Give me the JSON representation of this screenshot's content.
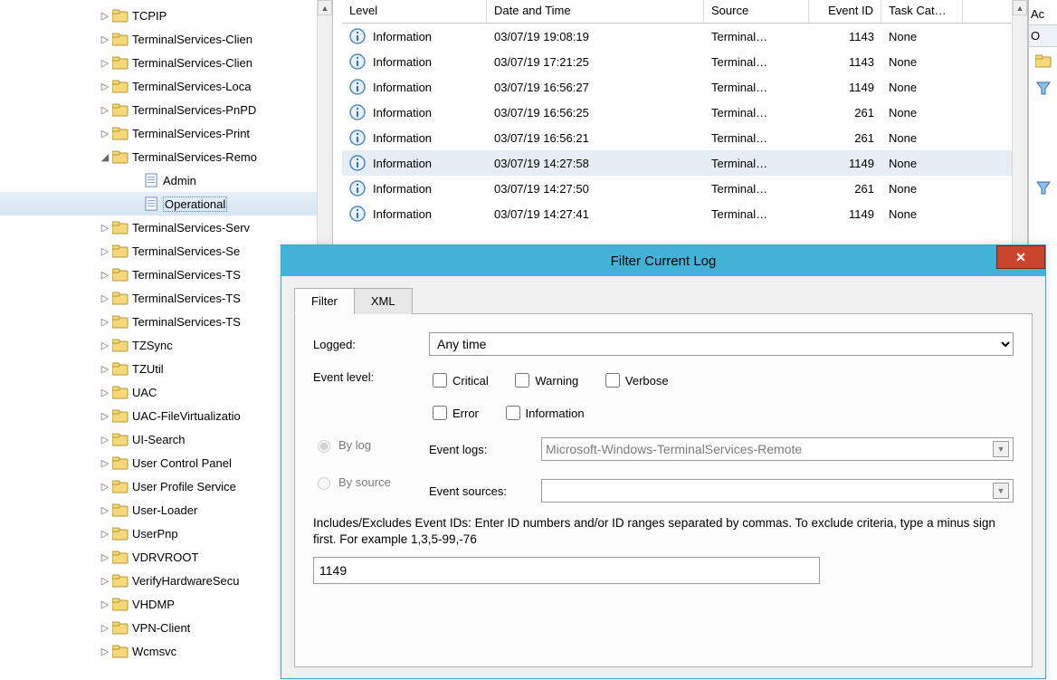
{
  "tree": [
    {
      "label": "TCPIP",
      "type": "folder",
      "tw": "▷"
    },
    {
      "label": "TerminalServices-Clien",
      "type": "folder",
      "tw": "▷"
    },
    {
      "label": "TerminalServices-Clien",
      "type": "folder",
      "tw": "▷"
    },
    {
      "label": "TerminalServices-Loca",
      "type": "folder",
      "tw": "▷"
    },
    {
      "label": "TerminalServices-PnPD",
      "type": "folder",
      "tw": "▷"
    },
    {
      "label": "TerminalServices-Print",
      "type": "folder",
      "tw": "▷"
    },
    {
      "label": "TerminalServices-Remo",
      "type": "folder",
      "tw": "◢",
      "expanded": true,
      "children": [
        {
          "label": "Admin",
          "type": "log"
        },
        {
          "label": "Operational",
          "type": "log",
          "selected": true
        }
      ]
    },
    {
      "label": "TerminalServices-Serv",
      "type": "folder",
      "tw": "▷"
    },
    {
      "label": "TerminalServices-Se",
      "type": "folder",
      "tw": "▷"
    },
    {
      "label": "TerminalServices-TS",
      "type": "folder",
      "tw": "▷"
    },
    {
      "label": "TerminalServices-TS",
      "type": "folder",
      "tw": "▷"
    },
    {
      "label": "TerminalServices-TS",
      "type": "folder",
      "tw": "▷"
    },
    {
      "label": "TZSync",
      "type": "folder",
      "tw": "▷"
    },
    {
      "label": "TZUtil",
      "type": "folder",
      "tw": "▷"
    },
    {
      "label": "UAC",
      "type": "folder",
      "tw": "▷"
    },
    {
      "label": "UAC-FileVirtualizatio",
      "type": "folder",
      "tw": "▷"
    },
    {
      "label": "UI-Search",
      "type": "folder",
      "tw": "▷"
    },
    {
      "label": "User Control Panel",
      "type": "folder",
      "tw": "▷"
    },
    {
      "label": "User Profile Service",
      "type": "folder",
      "tw": "▷"
    },
    {
      "label": "User-Loader",
      "type": "folder",
      "tw": "▷"
    },
    {
      "label": "UserPnp",
      "type": "folder",
      "tw": "▷"
    },
    {
      "label": "VDRVROOT",
      "type": "folder",
      "tw": "▷"
    },
    {
      "label": "VerifyHardwareSecu",
      "type": "folder",
      "tw": "▷"
    },
    {
      "label": "VHDMP",
      "type": "folder",
      "tw": "▷"
    },
    {
      "label": "VPN-Client",
      "type": "folder",
      "tw": "▷"
    },
    {
      "label": "Wcmsvc",
      "type": "folder",
      "tw": "▷"
    }
  ],
  "grid": {
    "headers": {
      "level": "Level",
      "date": "Date and Time",
      "source": "Source",
      "eventid": "Event ID",
      "task": "Task Cat…"
    },
    "rows": [
      {
        "level": "Information",
        "date": "03/07/19 19:08:19",
        "source": "Terminal…",
        "eventid": "1143",
        "task": "None"
      },
      {
        "level": "Information",
        "date": "03/07/19 17:21:25",
        "source": "Terminal…",
        "eventid": "1143",
        "task": "None"
      },
      {
        "level": "Information",
        "date": "03/07/19 16:56:27",
        "source": "Terminal…",
        "eventid": "1149",
        "task": "None"
      },
      {
        "level": "Information",
        "date": "03/07/19 16:56:25",
        "source": "Terminal…",
        "eventid": "261",
        "task": "None"
      },
      {
        "level": "Information",
        "date": "03/07/19 16:56:21",
        "source": "Terminal…",
        "eventid": "261",
        "task": "None"
      },
      {
        "level": "Information",
        "date": "03/07/19 14:27:58",
        "source": "Terminal…",
        "eventid": "1149",
        "task": "None",
        "selected": true
      },
      {
        "level": "Information",
        "date": "03/07/19 14:27:50",
        "source": "Terminal…",
        "eventid": "261",
        "task": "None"
      },
      {
        "level": "Information",
        "date": "03/07/19 14:27:41",
        "source": "Terminal…",
        "eventid": "1149",
        "task": "None"
      }
    ]
  },
  "actions": {
    "header": "Ac",
    "sub": "O"
  },
  "dialog": {
    "title": "Filter Current Log",
    "tabs": {
      "filter": "Filter",
      "xml": "XML"
    },
    "labels": {
      "logged": "Logged:",
      "eventlevel": "Event level:",
      "bylog": "By log",
      "bysource": "By source",
      "eventlogs": "Event logs:",
      "eventsources": "Event sources:"
    },
    "logged_value": "Any time",
    "levels": {
      "critical": "Critical",
      "warning": "Warning",
      "verbose": "Verbose",
      "error": "Error",
      "information": "Information"
    },
    "eventlogs_value": "Microsoft-Windows-TerminalServices-Remote",
    "eventsources_value": "",
    "help": "Includes/Excludes Event IDs: Enter ID numbers and/or ID ranges separated by commas. To exclude criteria, type a minus sign first. For example 1,3,5-99,-76",
    "id_value": "1149"
  }
}
